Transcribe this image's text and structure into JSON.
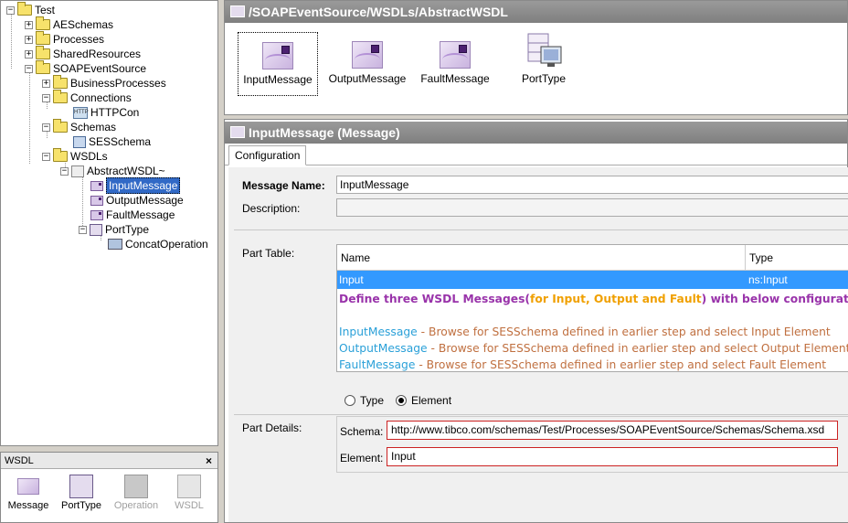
{
  "tree": {
    "items": [
      {
        "label": "Test"
      },
      {
        "label": "AESchemas"
      },
      {
        "label": "Processes"
      },
      {
        "label": "SharedResources"
      },
      {
        "label": "SOAPEventSource"
      },
      {
        "label": "BusinessProcesses"
      },
      {
        "label": "Connections"
      },
      {
        "label": "HTTPCon"
      },
      {
        "label": "Schemas"
      },
      {
        "label": "SESSchema"
      },
      {
        "label": "WSDLs"
      },
      {
        "label": "AbstractWSDL~"
      },
      {
        "label": "InputMessage"
      },
      {
        "label": "OutputMessage"
      },
      {
        "label": "FaultMessage"
      },
      {
        "label": "PortType"
      },
      {
        "label": "ConcatOperation"
      }
    ],
    "selected": "InputMessage"
  },
  "palette": {
    "title": "WSDL",
    "close": "×",
    "items": [
      {
        "label": "Message",
        "enabled": true
      },
      {
        "label": "PortType",
        "enabled": true
      },
      {
        "label": "Operation",
        "enabled": false
      },
      {
        "label": "WSDL",
        "enabled": false
      }
    ]
  },
  "designer": {
    "path": "/SOAPEventSource/WSDLs/AbstractWSDL",
    "items": [
      {
        "label": "InputMessage",
        "icon": "message-icon"
      },
      {
        "label": "OutputMessage",
        "icon": "message-icon"
      },
      {
        "label": "FaultMessage",
        "icon": "message-icon"
      },
      {
        "label": "PortType",
        "icon": "porttype-icon"
      }
    ]
  },
  "props": {
    "title": "InputMessage (Message)",
    "tab": "Configuration",
    "message_name_label": "Message Name:",
    "message_name_value": "InputMessage",
    "description_label": "Description:",
    "description_value": "",
    "part_table_label": "Part Table:",
    "columns": [
      "Name",
      "Type"
    ],
    "rows": [
      {
        "name": "Input",
        "type": "ns:Input"
      }
    ],
    "type_radio": "Type",
    "element_radio": "Element",
    "selected_radio": "Element",
    "part_details_label": "Part Details:",
    "schema_label": "Schema:",
    "schema_value": "http://www.tibco.com/schemas/Test/Processes/SOAPEventSource/Schemas/Schema.xsd",
    "element_label": "Element:",
    "element_value": "Input"
  },
  "annotation": {
    "heading_a": "Define three WSDL Messages(",
    "heading_b": "for Input, Output and Fault",
    "heading_c": ") with below configuration :",
    "lines": [
      {
        "name": "InputMessage",
        "text": " - Browse for SESSchema defined in earlier step and select Input Element"
      },
      {
        "name": "OutputMessage",
        "text": " - Browse for SESSchema defined in earlier step and select Output Element"
      },
      {
        "name": "FaultMessage",
        "text": " - Browse for SESSchema defined in earlier step and select Fault Element"
      }
    ],
    "colors": {
      "purple": "#9933aa",
      "orange": "#f0a000",
      "blue": "#2aa0d8",
      "brown": "#c07040"
    }
  }
}
